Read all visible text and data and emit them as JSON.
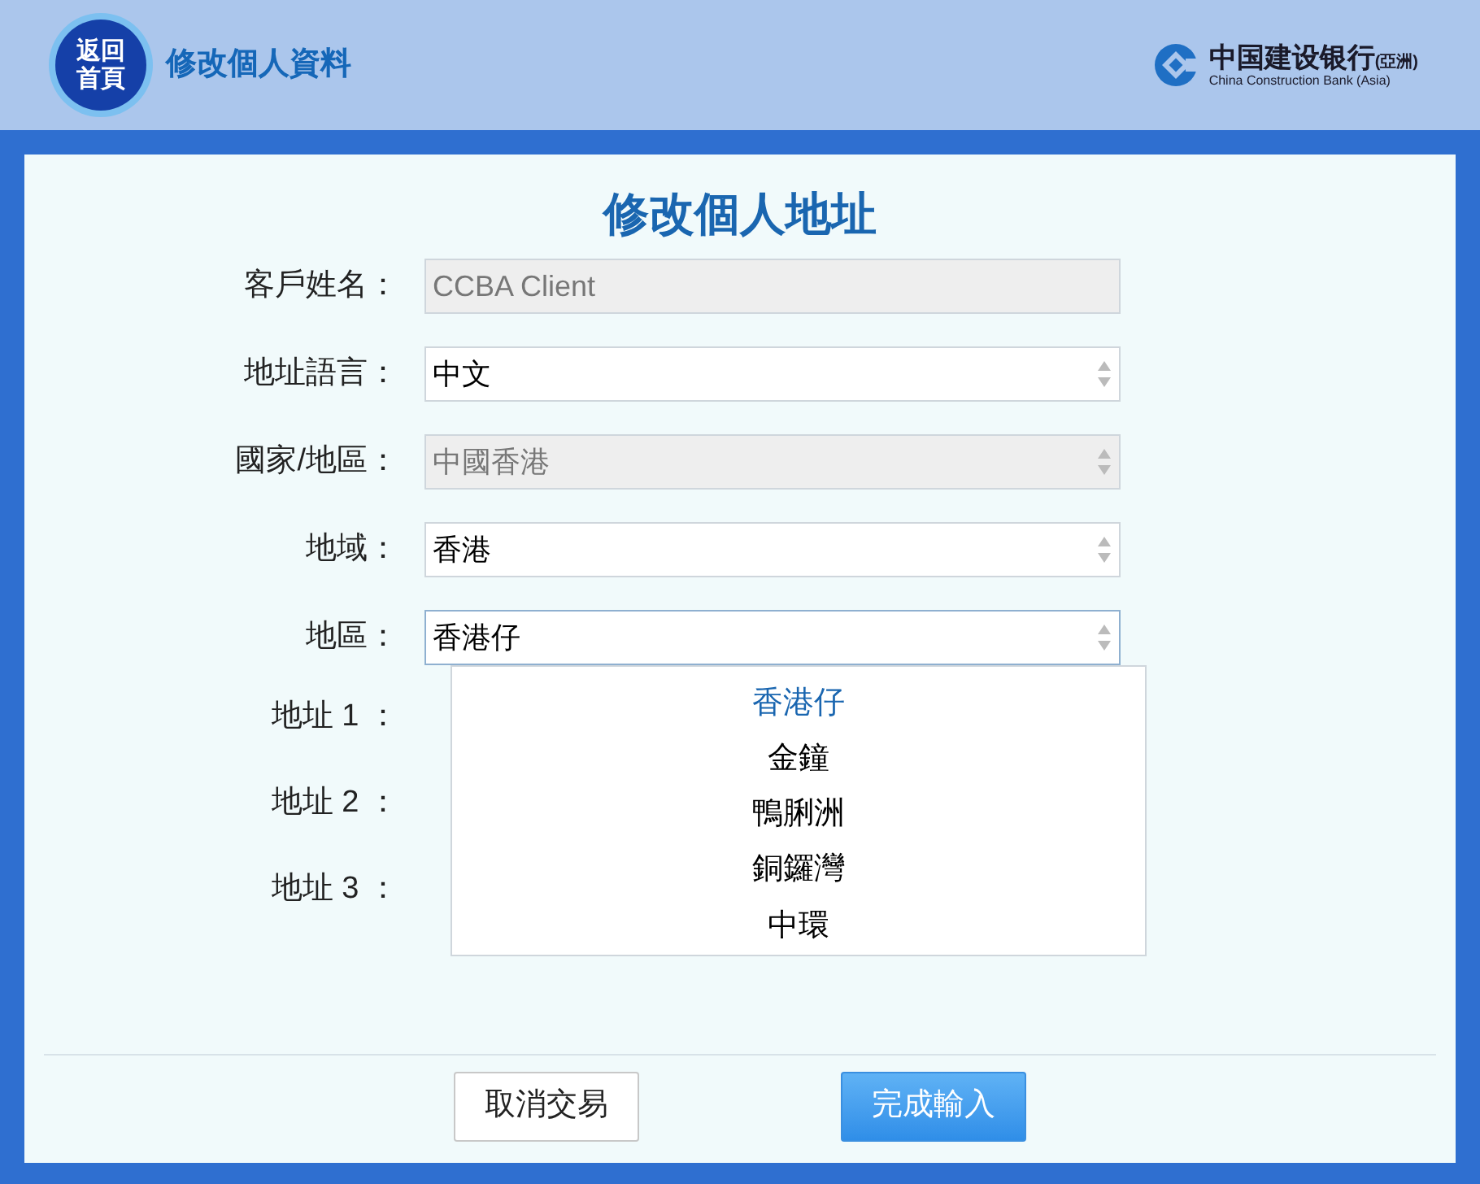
{
  "header": {
    "home_button": "返回首頁",
    "title": "修改個人資料",
    "logo": {
      "chinese": "中国建设银行",
      "suffix": "(亞洲)",
      "english": "China Construction Bank (Asia)"
    }
  },
  "form": {
    "title": "修改個人地址",
    "fields": [
      {
        "label": "客戶姓名：",
        "kind": "text",
        "value": "CCBA Client",
        "disabled": true
      },
      {
        "label": "地址語言：",
        "kind": "select",
        "value": "中文",
        "disabled": false
      },
      {
        "label": "國家/地區：",
        "kind": "select",
        "value": "中國香港",
        "disabled": true
      },
      {
        "label": "地域：",
        "kind": "select",
        "value": "香港",
        "disabled": false
      },
      {
        "label": "地區：",
        "kind": "select",
        "value": "香港仔",
        "disabled": false,
        "expanded": true
      }
    ],
    "dropdown": [
      {
        "label": "香港仔",
        "selected": true
      },
      {
        "label": "金鐘",
        "selected": false
      },
      {
        "label": "鴨脷洲",
        "selected": false
      },
      {
        "label": "銅鑼灣",
        "selected": false
      },
      {
        "label": "中環",
        "selected": false
      }
    ],
    "address_labels": [
      "地址 1 ：",
      "地址 2 ：",
      "地址 3 ："
    ]
  },
  "buttons": [
    {
      "label": "取消交易",
      "kind": "secondary"
    },
    {
      "label": "完成輸入",
      "kind": "primary"
    }
  ]
}
